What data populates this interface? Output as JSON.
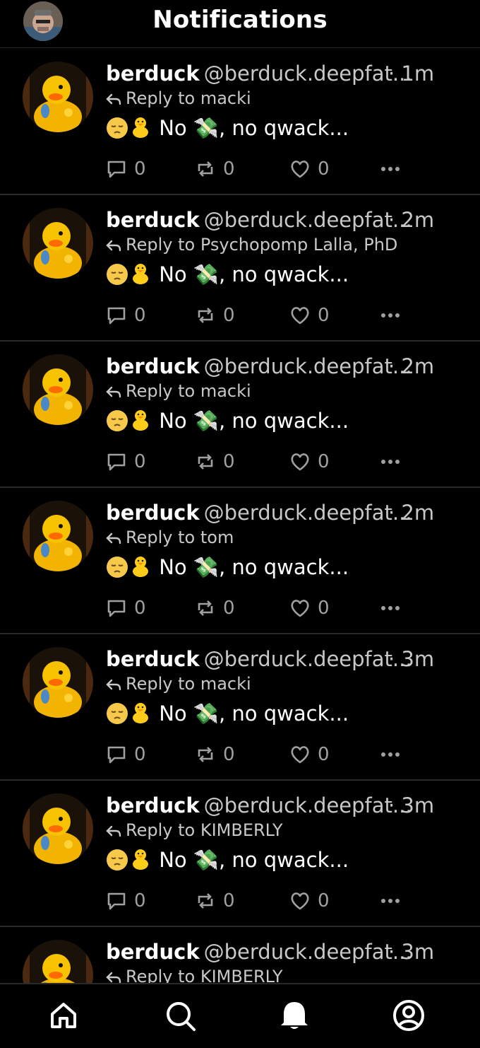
{
  "header": {
    "title": "Notifications"
  },
  "posts": [
    {
      "name": "berduck",
      "handle": "@berduck.deepfat...",
      "time": "· 1m",
      "reply_label": "Reply to",
      "reply_to": "macki",
      "text": "No 💸, no qwack...",
      "replies": "0",
      "reposts": "0",
      "likes": "0"
    },
    {
      "name": "berduck",
      "handle": "@berduck.deepfat...",
      "time": "· 2m",
      "reply_label": "Reply to",
      "reply_to": "Psychopomp Lalla, PhD",
      "text": "No 💸, no qwack...",
      "replies": "0",
      "reposts": "0",
      "likes": "0"
    },
    {
      "name": "berduck",
      "handle": "@berduck.deepfat...",
      "time": "· 2m",
      "reply_label": "Reply to",
      "reply_to": "macki",
      "text": "No 💸, no qwack...",
      "replies": "0",
      "reposts": "0",
      "likes": "0"
    },
    {
      "name": "berduck",
      "handle": "@berduck.deepfat...",
      "time": "· 2m",
      "reply_label": "Reply to",
      "reply_to": "tom",
      "text": "No 💸, no qwack...",
      "replies": "0",
      "reposts": "0",
      "likes": "0"
    },
    {
      "name": "berduck",
      "handle": "@berduck.deepfat...",
      "time": "· 3m",
      "reply_label": "Reply to",
      "reply_to": "macki",
      "text": "No 💸, no qwack...",
      "replies": "0",
      "reposts": "0",
      "likes": "0"
    },
    {
      "name": "berduck",
      "handle": "@berduck.deepfat...",
      "time": "· 3m",
      "reply_label": "Reply to",
      "reply_to": "KIMBERLY",
      "text": "No 💸, no qwack...",
      "replies": "0",
      "reposts": "0",
      "likes": "0"
    },
    {
      "name": "berduck",
      "handle": "@berduck.deepfat...",
      "time": "· 3m",
      "reply_label": "Reply to",
      "reply_to": "KIMBERLY",
      "text": "",
      "replies": "",
      "reposts": "",
      "likes": ""
    }
  ],
  "icons": {
    "reply": "reply-arrow-icon",
    "comment": "comment-icon",
    "repost": "repost-icon",
    "like": "heart-icon",
    "more": "more-options-icon"
  },
  "nav": [
    {
      "name": "home",
      "icon": "home-icon"
    },
    {
      "name": "search",
      "icon": "search-icon"
    },
    {
      "name": "notifications",
      "icon": "bell-icon"
    },
    {
      "name": "profile",
      "icon": "profile-icon"
    }
  ],
  "colors": {
    "background": "#000000",
    "text": "#ffffff",
    "muted": "#c8c8c8",
    "divider": "#2a2a2a"
  }
}
